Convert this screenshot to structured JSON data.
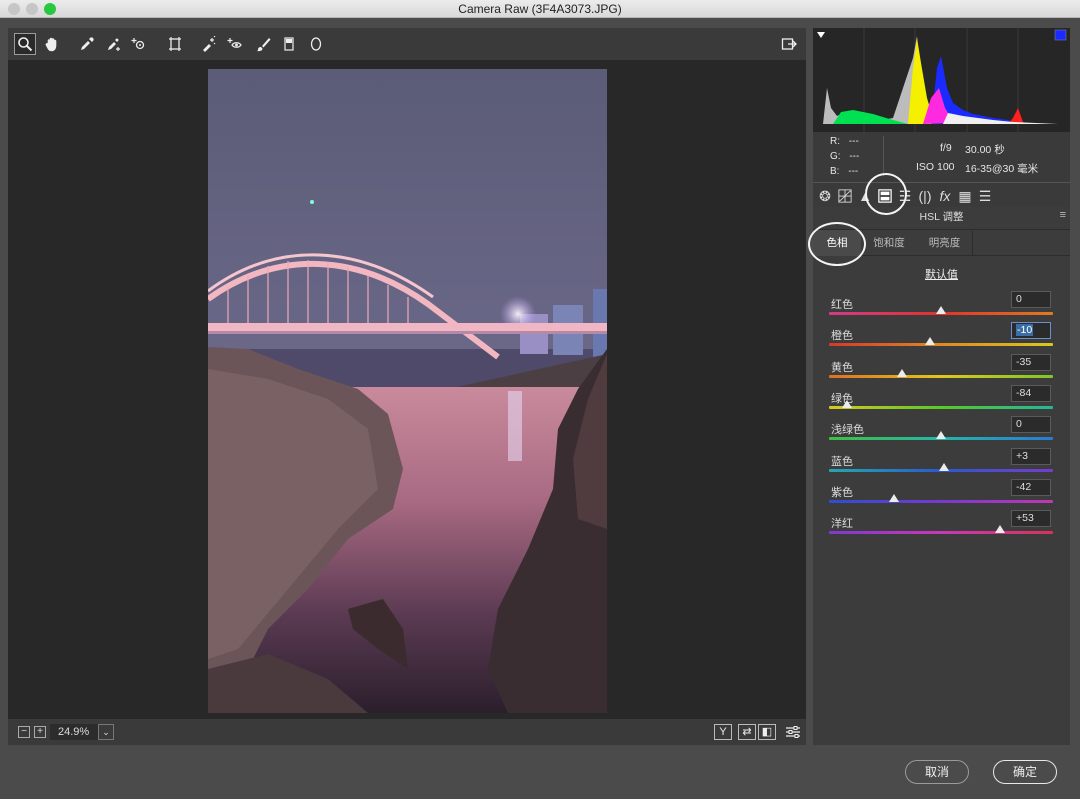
{
  "window": {
    "title": "Camera Raw (3F4A3073.JPG)",
    "traffic_lights": {
      "close": "#ff5f57",
      "minimize": "#febc2e",
      "zoom": "#28c840"
    }
  },
  "toolbar": {
    "tools": [
      {
        "name": "zoom-tool",
        "icon": "magnifier-icon"
      },
      {
        "name": "hand-tool",
        "icon": "hand-icon"
      },
      {
        "name": "white-balance-tool",
        "icon": "eyedropper-icon"
      },
      {
        "name": "color-sampler-tool",
        "icon": "color-sampler-icon"
      },
      {
        "name": "targeted-adjustment-tool",
        "icon": "target-icon"
      },
      {
        "name": "transform-tool",
        "icon": "transform-icon"
      },
      {
        "name": "spot-removal-tool",
        "icon": "spot-removal-icon"
      },
      {
        "name": "red-eye-tool",
        "icon": "red-eye-icon"
      },
      {
        "name": "adjustment-brush-tool",
        "icon": "brush-icon"
      },
      {
        "name": "graduated-filter-tool",
        "icon": "graduated-filter-icon"
      },
      {
        "name": "radial-filter-tool",
        "icon": "radial-filter-icon"
      }
    ],
    "open_preferences_icon": "export-icon"
  },
  "statusbar": {
    "zoom_out": "−",
    "zoom_in": "+",
    "zoom_level": "24.9%",
    "view_buttons": [
      "Y",
      "⇄",
      "◧",
      "☰"
    ]
  },
  "info": {
    "r_label": "R:",
    "r_value": "---",
    "g_label": "G:",
    "g_value": "---",
    "b_label": "B:",
    "b_value": "---",
    "aperture": "f/9",
    "shutter": "30.00 秒",
    "iso": "ISO 100",
    "lens": "16-35@30 毫米"
  },
  "panel_tabs": [
    "basic-icon",
    "tone-curve-icon",
    "detail-icon",
    "hsl-icon",
    "split-toning-icon",
    "lens-icon",
    "fx-icon",
    "calibration-icon",
    "presets-icon"
  ],
  "panel": {
    "title": "HSL 调整",
    "subtabs": [
      "色相",
      "饱和度",
      "明亮度"
    ],
    "active_subtab": "色相",
    "default_label": "默认值",
    "sliders": [
      {
        "label": "红色",
        "value": "0",
        "num": 0
      },
      {
        "label": "橙色",
        "value": "-10",
        "num": -10
      },
      {
        "label": "黄色",
        "value": "-35",
        "num": -35
      },
      {
        "label": "绿色",
        "value": "-84",
        "num": -84
      },
      {
        "label": "浅绿色",
        "value": "0",
        "num": 0
      },
      {
        "label": "蓝色",
        "value": "+3",
        "num": 3
      },
      {
        "label": "紫色",
        "value": "-42",
        "num": -42
      },
      {
        "label": "洋红",
        "value": "+53",
        "num": 53
      }
    ],
    "slider_range": [
      -100,
      100
    ]
  },
  "buttons": {
    "cancel": "取消",
    "ok": "确定"
  }
}
